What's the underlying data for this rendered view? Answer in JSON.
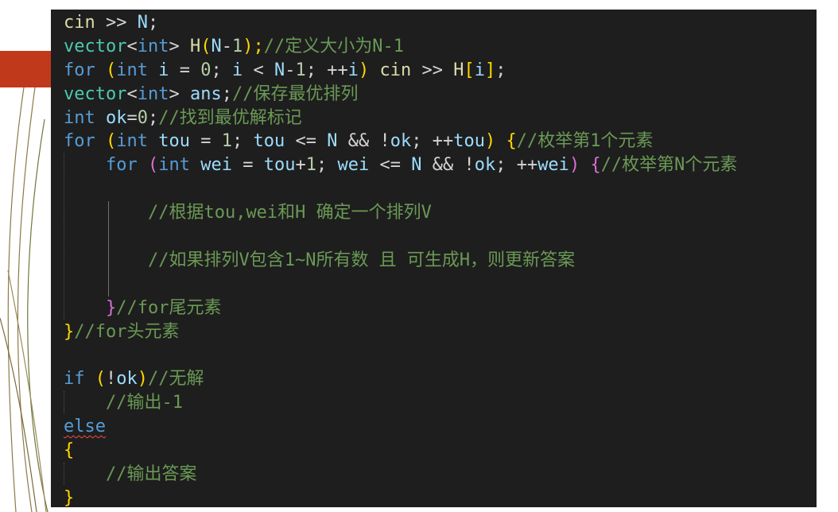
{
  "code_lines": [
    "cin >> N;",
    "vector<int> H(N-1);//定义大小为N-1",
    "for (int i = 0; i < N-1; ++i) cin >> H[i];",
    "vector<int> ans;//保存最优排列",
    "int ok=0;//找到最优解标记",
    "for (int tou = 1; tou <= N && !ok; ++tou) {//枚举第1个元素",
    "    for (int wei = tou+1; wei <= N && !ok; ++wei) {//枚举第N个元素",
    "",
    "        //根据tou,wei和H 确定一个排列V",
    "",
    "        //如果排列V包含1~N所有数 且 可生成H，则更新答案",
    "",
    "    }//for尾元素",
    "}//for头元素",
    "",
    "if (!ok)//无解",
    "    //输出-1",
    "else",
    "{",
    "    //输出答案",
    "}"
  ],
  "tokens": {
    "l1": [
      "cin",
      " >> ",
      "N",
      ";"
    ],
    "l2": [
      "vector",
      "<",
      "int",
      "> ",
      "H",
      "(",
      "N",
      "-",
      "1",
      ");",
      "//定义大小为N-1"
    ],
    "l3": [
      "for",
      " ",
      "(",
      "int",
      " ",
      "i",
      " = ",
      "0",
      "; ",
      "i",
      " < ",
      "N",
      "-",
      "1",
      "; ++",
      "i",
      ")",
      " ",
      "cin",
      " >> ",
      "H",
      "[",
      "i",
      "]",
      ";"
    ],
    "l4": [
      "vector",
      "<",
      "int",
      "> ",
      "ans",
      ";",
      "//保存最优排列"
    ],
    "l5": [
      "int",
      " ",
      "ok",
      "=",
      "0",
      ";",
      "//找到最优解标记"
    ],
    "l6": [
      "for",
      " ",
      "(",
      "int",
      " ",
      "tou",
      " = ",
      "1",
      "; ",
      "tou",
      " <= ",
      "N",
      " && !",
      "ok",
      "; ++",
      "tou",
      ")",
      " ",
      "{",
      "//枚举第1个元素"
    ],
    "l7": [
      "    ",
      "for",
      " ",
      "(",
      "int",
      " ",
      "wei",
      " = ",
      "tou",
      "+",
      "1",
      "; ",
      "wei",
      " <= ",
      "N",
      " && !",
      "ok",
      "; ++",
      "wei",
      ")",
      " ",
      "{",
      "//枚举第N个元素"
    ],
    "l9": [
      "        ",
      "//根据tou,wei和H 确定一个排列V"
    ],
    "l11": [
      "        ",
      "//如果排列V包含1~N所有数 且 可生成H，则更新答案"
    ],
    "l13": [
      "    ",
      "}",
      "//for尾元素"
    ],
    "l14": [
      "}",
      "//for头元素"
    ],
    "l16": [
      "if",
      " ",
      "(",
      "!",
      "ok",
      ")",
      "//无解"
    ],
    "l17": [
      "    ",
      "//输出-1"
    ],
    "l18": [
      "else"
    ],
    "l19": [
      "{"
    ],
    "l20": [
      "    ",
      "//输出答案"
    ],
    "l21": [
      "}"
    ]
  },
  "colors": {
    "editor_background": "#1e1e1e",
    "accent_bar": "#c0391b",
    "keyword": "#569cd6",
    "function": "#dcdcaa",
    "type": "#4ec9b0",
    "variable": "#9cdcfe",
    "number": "#b5cea8",
    "comment": "#6a9955",
    "bracket_gold": "#ffd700",
    "bracket_orchid": "#da70d6",
    "bracket_blue": "#179fff"
  }
}
